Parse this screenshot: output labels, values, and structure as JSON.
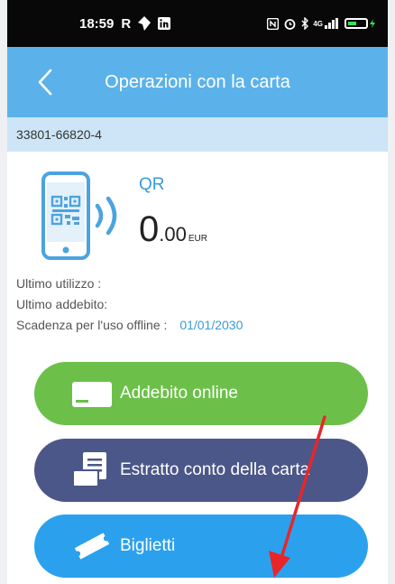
{
  "status_bar": {
    "time": "18:59",
    "left_glyphs": [
      "R"
    ],
    "right_text": "4G",
    "icons": [
      "location-icon",
      "linkedin-icon",
      "nfc-icon",
      "alarm-icon",
      "bluetooth-icon",
      "signal-icon",
      "battery-icon"
    ]
  },
  "header": {
    "title": "Operazioni con la carta",
    "back_icon": "chevron-left-icon"
  },
  "card": {
    "number": "33801-66820-4"
  },
  "qr": {
    "label": "QR",
    "balance_int": "0",
    "balance_dec": ".00",
    "currency": "EUR",
    "icon": "phone-qr-icon"
  },
  "info": {
    "last_use_label": "Ultimo utilizzo   :",
    "last_use_value": "",
    "last_charge_label": "Ultimo addebito:",
    "last_charge_value": "",
    "offline_label": "Scadenza per l'uso offline :",
    "offline_value": "01/01/2030"
  },
  "actions": {
    "online_label": "Addebito online",
    "statement_label": "Estratto conto della carta",
    "tickets_label": "Biglietti"
  },
  "colors": {
    "header": "#5bb2ea",
    "id_bar": "#cde5f6",
    "accent": "#3a9ad8",
    "btn_online": "#6cc04a",
    "btn_statement": "#4b5788",
    "btn_tickets": "#2ba1ee",
    "annotation_arrow": "#e8262a"
  }
}
